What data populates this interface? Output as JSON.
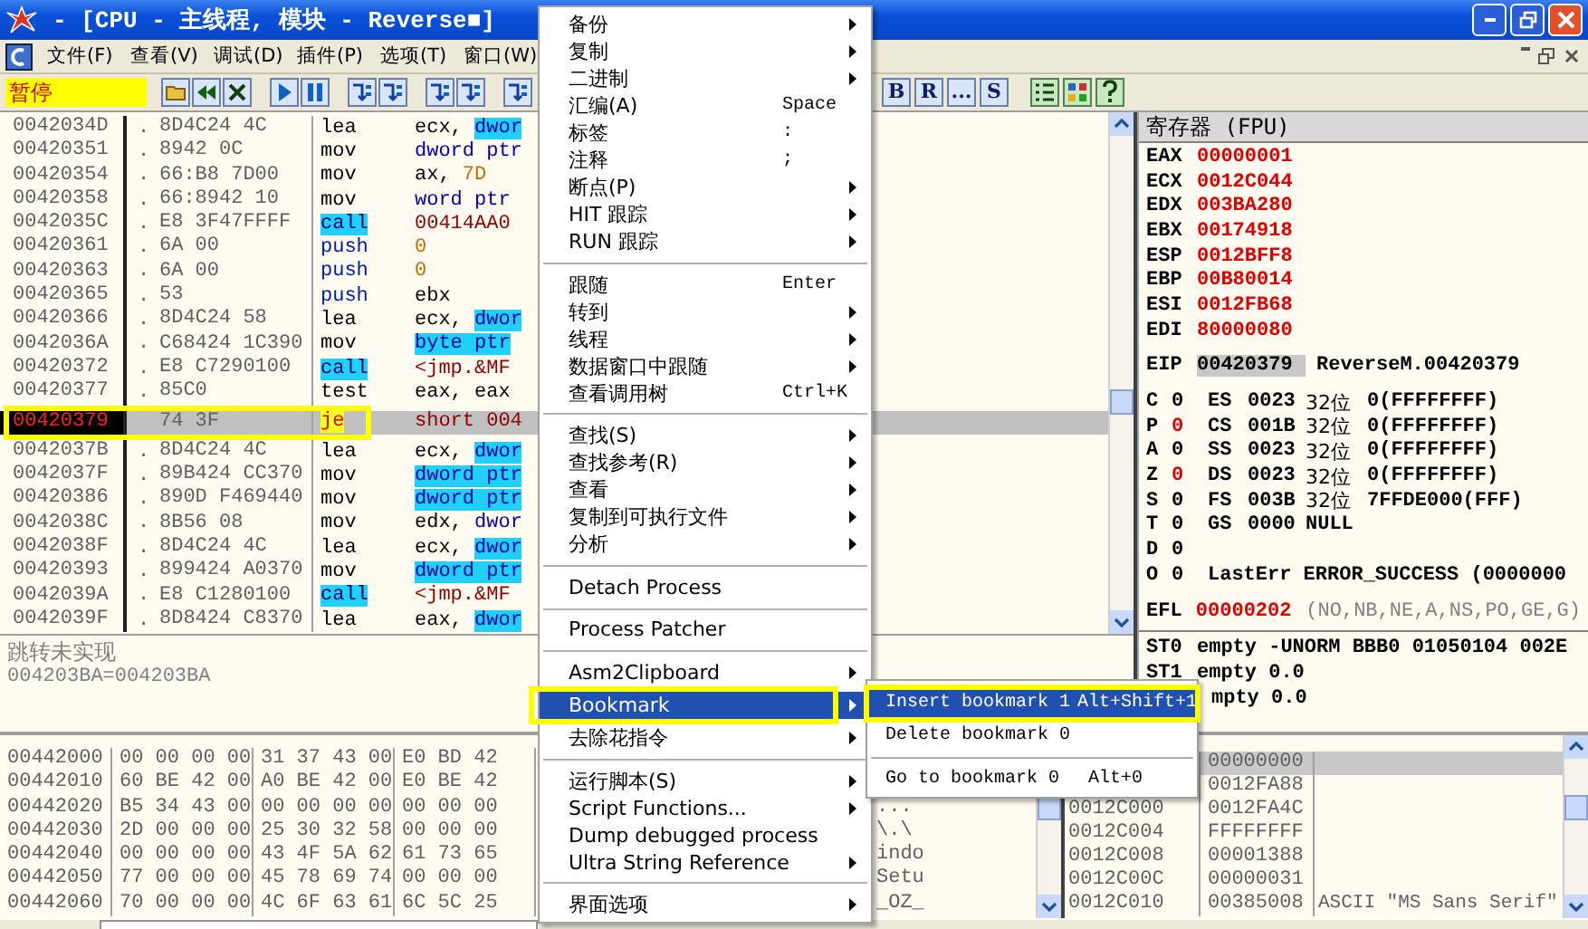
{
  "window": {
    "title": "- [CPU -  主线程, 模块 - Reverse■]"
  },
  "menubar": [
    {
      "label": "文件(F)"
    },
    {
      "label": "查看(V)"
    },
    {
      "label": "调试(D)"
    },
    {
      "label": "插件(P)"
    },
    {
      "label": "选项(T)"
    },
    {
      "label": "窗口(W)"
    }
  ],
  "toolbar": {
    "status": "暂停",
    "letter_buttons": [
      "B",
      "R",
      "...",
      "S"
    ]
  },
  "disassembly": [
    {
      "address": "0042034D",
      "path": ".",
      "hex": "8D4C24 4C",
      "mnemonic": "lea",
      "kind": "plain",
      "operand": [
        {
          "text": "ecx, ",
          "kind": "plain"
        },
        {
          "text": "dwor",
          "kind": "mem"
        }
      ],
      "selected": false
    },
    {
      "address": "00420351",
      "path": ".",
      "hex": "8942 0C",
      "mnemonic": "mov",
      "kind": "plain",
      "operand": [
        {
          "text": "dword ptr",
          "kind": "ptr"
        }
      ],
      "selected": false
    },
    {
      "address": "00420354",
      "path": ".",
      "hex": "66:B8 7D00",
      "mnemonic": "mov",
      "kind": "plain",
      "operand": [
        {
          "text": "ax, ",
          "kind": "plain"
        },
        {
          "text": "7D",
          "kind": "num"
        }
      ],
      "selected": false
    },
    {
      "address": "00420358",
      "path": ".",
      "hex": "66:8942 10",
      "mnemonic": "mov",
      "kind": "plain",
      "operand": [
        {
          "text": "word ptr",
          "kind": "ptr"
        }
      ],
      "selected": false
    },
    {
      "address": "0042035C",
      "path": ".",
      "hex": "E8 3F47FFFF",
      "mnemonic": "call",
      "kind": "call",
      "operand": [
        {
          "text": "00414AA0",
          "kind": "target"
        }
      ],
      "selected": false
    },
    {
      "address": "00420361",
      "path": ".",
      "hex": "6A 00",
      "mnemonic": "push",
      "kind": "push",
      "operand": [
        {
          "text": "0",
          "kind": "num"
        }
      ],
      "selected": false
    },
    {
      "address": "00420363",
      "path": ".",
      "hex": "6A 00",
      "mnemonic": "push",
      "kind": "push",
      "operand": [
        {
          "text": "0",
          "kind": "num"
        }
      ],
      "selected": false
    },
    {
      "address": "00420365",
      "path": ".",
      "hex": "53",
      "mnemonic": "push",
      "kind": "push",
      "operand": [
        {
          "text": "ebx",
          "kind": "plain"
        }
      ],
      "selected": false
    },
    {
      "address": "00420366",
      "path": ".",
      "hex": "8D4C24 58",
      "mnemonic": "lea",
      "kind": "plain",
      "operand": [
        {
          "text": "ecx, ",
          "kind": "plain"
        },
        {
          "text": "dwor",
          "kind": "mem"
        }
      ],
      "selected": false
    },
    {
      "address": "0042036A",
      "path": ".",
      "hex": "C68424 1C390",
      "mnemonic": "mov",
      "kind": "plain",
      "operand": [
        {
          "text": "byte ptr",
          "kind": "mem"
        }
      ],
      "selected": false
    },
    {
      "address": "00420372",
      "path": ".",
      "hex": "E8 C7290100",
      "mnemonic": "call",
      "kind": "call",
      "operand": [
        {
          "text": "<jmp.&MF",
          "kind": "target"
        }
      ],
      "selected": false
    },
    {
      "address": "00420377",
      "path": ".",
      "hex": "85C0",
      "mnemonic": "test",
      "kind": "plain",
      "operand": [
        {
          "text": "eax, eax",
          "kind": "plain"
        }
      ],
      "selected": false
    },
    {
      "address": "00420379",
      "hex": "74 3F",
      "mnemonic": "je",
      "kind": "jump",
      "operand": [
        {
          "text": "short 004",
          "kind": "target"
        }
      ],
      "selected": true,
      "highlighted": true
    },
    {
      "address": "0042037B",
      "path": ".",
      "hex": "8D4C24 4C",
      "mnemonic": "lea",
      "kind": "plain",
      "operand": [
        {
          "text": "ecx, ",
          "kind": "plain"
        },
        {
          "text": "dwor",
          "kind": "mem"
        }
      ],
      "selected": false
    },
    {
      "address": "0042037F",
      "path": ".",
      "hex": "89B424 CC370",
      "mnemonic": "mov",
      "kind": "plain",
      "operand": [
        {
          "text": "dword ptr",
          "kind": "mem"
        }
      ],
      "selected": false
    },
    {
      "address": "00420386",
      "path": ".",
      "hex": "890D F469440",
      "mnemonic": "mov",
      "kind": "plain",
      "operand": [
        {
          "text": "dword ptr",
          "kind": "mem"
        }
      ],
      "selected": false
    },
    {
      "address": "0042038C",
      "path": ".",
      "hex": "8B56 08",
      "mnemonic": "mov",
      "kind": "plain",
      "operand": [
        {
          "text": "edx, ",
          "kind": "plain"
        },
        {
          "text": "dwor",
          "kind": "ptr"
        }
      ],
      "selected": false
    },
    {
      "address": "0042038F",
      "path": ".",
      "hex": "8D4C24 4C",
      "mnemonic": "lea",
      "kind": "plain",
      "operand": [
        {
          "text": "ecx, ",
          "kind": "plain"
        },
        {
          "text": "dwor",
          "kind": "mem"
        }
      ],
      "selected": false
    },
    {
      "address": "00420393",
      "path": ".",
      "hex": "899424 A0370",
      "mnemonic": "mov",
      "kind": "plain",
      "operand": [
        {
          "text": "dword ptr",
          "kind": "mem"
        }
      ],
      "selected": false
    },
    {
      "address": "0042039A",
      "path": ".",
      "hex": "E8 C1280100",
      "mnemonic": "call",
      "kind": "call",
      "operand": [
        {
          "text": "<jmp.&MF",
          "kind": "target"
        }
      ],
      "selected": false
    },
    {
      "address": "0042039F",
      "path": ".",
      "hex": "8D8424 C8370",
      "mnemonic": "lea",
      "kind": "plain",
      "operand": [
        {
          "text": "eax, ",
          "kind": "plain"
        },
        {
          "text": "dwor",
          "kind": "mem"
        }
      ],
      "selected": false
    }
  ],
  "info": [
    "跳转未实现",
    "004203BA=004203BA"
  ],
  "registers": {
    "title": "寄存器 (FPU)",
    "general": [
      {
        "name": "EAX",
        "value": "00000001",
        "changed": true
      },
      {
        "name": "ECX",
        "value": "0012C044",
        "changed": true
      },
      {
        "name": "EDX",
        "value": "003BA280",
        "changed": true
      },
      {
        "name": "EBX",
        "value": "00174918",
        "changed": true
      },
      {
        "name": "ESP",
        "value": "0012BFF8",
        "changed": true
      },
      {
        "name": "EBP",
        "value": "00B80014",
        "changed": true
      },
      {
        "name": "ESI",
        "value": "0012FB68",
        "changed": true
      },
      {
        "name": "EDI",
        "value": "80000080",
        "changed": true
      }
    ],
    "eip": {
      "name": "EIP",
      "value": "00420379",
      "comment": "ReverseM.00420379"
    },
    "flags": [
      {
        "flag": "C",
        "value": "0",
        "changed": false,
        "segment": "ES",
        "selector": "0023",
        "bits": "32位",
        "info": "0(FFFFFFFF)"
      },
      {
        "flag": "P",
        "value": "0",
        "changed": true,
        "segment": "CS",
        "selector": "001B",
        "bits": "32位",
        "info": "0(FFFFFFFF)"
      },
      {
        "flag": "A",
        "value": "0",
        "changed": false,
        "segment": "SS",
        "selector": "0023",
        "bits": "32位",
        "info": "0(FFFFFFFF)"
      },
      {
        "flag": "Z",
        "value": "0",
        "changed": true,
        "segment": "DS",
        "selector": "0023",
        "bits": "32位",
        "info": "0(FFFFFFFF)"
      },
      {
        "flag": "S",
        "value": "0",
        "changed": false,
        "segment": "FS",
        "selector": "003B",
        "bits": "32位",
        "info": "7FFDE000(FFF)"
      },
      {
        "flag": "T",
        "value": "0",
        "changed": false,
        "segment": "GS",
        "selector": "0000",
        "info": "NULL"
      },
      {
        "flag": "D",
        "value": "0",
        "changed": false
      },
      {
        "flag": "O",
        "value": "0",
        "changed": false,
        "info": "LastErr ERROR_SUCCESS (0000000"
      }
    ],
    "efl": {
      "name": "EFL",
      "value": "00000202",
      "changed": true,
      "info": "(NO,NB,NE,A,NS,PO,GE,G)"
    },
    "fpu": [
      {
        "name": "ST0",
        "text": "empty -UNORM BBB0 01050104 002E"
      },
      {
        "name": "ST1",
        "text": "empty 0.0"
      },
      {
        "text": "mpty 0.0"
      }
    ]
  },
  "dump": [
    {
      "address": "00442000",
      "groups": [
        "00 00 00 00",
        "31 37 43 00",
        "E0 BD 42"
      ]
    },
    {
      "address": "00442010",
      "groups": [
        "60 BE 42 00",
        "A0 BE 42 00",
        "E0 BE 42"
      ]
    },
    {
      "address": "00442020",
      "groups": [
        "B5 34 43 00",
        "00 00 00 00",
        "00 00 00"
      ],
      "ascii": "..."
    },
    {
      "address": "00442030",
      "groups": [
        "2D 00 00 00",
        "25 30 32 58",
        "00 00 00"
      ],
      "ascii": "\\.\\"
    },
    {
      "address": "00442040",
      "groups": [
        "00 00 00 00",
        "43 4F 5A 62",
        "61 73 65"
      ],
      "ascii": "indo"
    },
    {
      "address": "00442050",
      "groups": [
        "77 00 00 00",
        "45 78 69 74",
        "00 00 00"
      ],
      "ascii": "Setu"
    },
    {
      "address": "00442060",
      "groups": [
        "70 00 00 00",
        "4C 6F 63 61",
        "6C 5C 25"
      ],
      "ascii": "_OZ_"
    }
  ],
  "stack": [
    {
      "value": "00000000",
      "selected": true
    },
    {
      "value": "0012FA88",
      "selected": false
    },
    {
      "address": "0012C000",
      "value": "0012FA4C",
      "selected": false
    },
    {
      "address": "0012C004",
      "value": "FFFFFFFF",
      "selected": false
    },
    {
      "address": "0012C008",
      "value": "00001388",
      "selected": false
    },
    {
      "address": "0012C00C",
      "value": "00000031",
      "selected": false
    },
    {
      "address": "0012C010",
      "value": "00385008",
      "comment": "ASCII \"MS Sans Serif\"",
      "selected": false
    }
  ],
  "context_menu": [
    {
      "kind": "item",
      "label": "备份",
      "submenu": true,
      "selected": false
    },
    {
      "kind": "item",
      "label": "复制",
      "submenu": true,
      "selected": false
    },
    {
      "kind": "item",
      "label": "二进制",
      "submenu": true,
      "selected": false
    },
    {
      "kind": "item",
      "label": "汇编(A)",
      "shortcut": "Space",
      "submenu": false,
      "selected": false
    },
    {
      "kind": "item",
      "label": "标签",
      "shortcut": ":",
      "submenu": false,
      "selected": false
    },
    {
      "kind": "item",
      "label": "注释",
      "shortcut": ";",
      "submenu": false,
      "selected": false
    },
    {
      "kind": "item",
      "label": "断点(P)",
      "submenu": true,
      "selected": false
    },
    {
      "kind": "item",
      "label": "HIT 跟踪",
      "submenu": true,
      "selected": false
    },
    {
      "kind": "item",
      "label": "RUN 跟踪",
      "submenu": true,
      "selected": false
    },
    {
      "kind": "separator"
    },
    {
      "kind": "item",
      "label": "跟随",
      "shortcut": "Enter",
      "submenu": false,
      "selected": false
    },
    {
      "kind": "item",
      "label": "转到",
      "submenu": true,
      "selected": false
    },
    {
      "kind": "item",
      "label": "线程",
      "submenu": true,
      "selected": false
    },
    {
      "kind": "item",
      "label": "数据窗口中跟随",
      "submenu": true,
      "selected": false
    },
    {
      "kind": "item",
      "label": "查看调用树",
      "shortcut": "Ctrl+K",
      "submenu": false,
      "selected": false
    },
    {
      "kind": "separator"
    },
    {
      "kind": "item",
      "label": "查找(S)",
      "submenu": true,
      "selected": false
    },
    {
      "kind": "item",
      "label": "查找参考(R)",
      "submenu": true,
      "selected": false
    },
    {
      "kind": "item",
      "label": "查看",
      "submenu": true,
      "selected": false
    },
    {
      "kind": "item",
      "label": "复制到可执行文件",
      "submenu": true,
      "selected": false
    },
    {
      "kind": "item",
      "label": "分析",
      "submenu": true,
      "selected": false
    },
    {
      "kind": "separator"
    },
    {
      "kind": "item",
      "label": "Detach Process",
      "submenu": false,
      "selected": false
    },
    {
      "kind": "separator"
    },
    {
      "kind": "item",
      "label": "Process Patcher",
      "submenu": false,
      "selected": false
    },
    {
      "kind": "separator"
    },
    {
      "kind": "item",
      "label": "Asm2Clipboard",
      "submenu": true,
      "selected": false
    },
    {
      "kind": "item",
      "label": "Bookmark",
      "submenu": true,
      "selected": true,
      "highlighted": true
    },
    {
      "kind": "item",
      "label": "去除花指令",
      "submenu": true,
      "selected": false
    },
    {
      "kind": "separator"
    },
    {
      "kind": "item",
      "label": "运行脚本(S)",
      "submenu": true,
      "selected": false
    },
    {
      "kind": "item",
      "label": "Script Functions...",
      "submenu": true,
      "selected": false
    },
    {
      "kind": "item",
      "label": "Dump debugged process",
      "submenu": false,
      "selected": false
    },
    {
      "kind": "item",
      "label": "Ultra String Reference",
      "submenu": true,
      "selected": false
    },
    {
      "kind": "separator"
    },
    {
      "kind": "item",
      "label": "界面选项",
      "submenu": true,
      "selected": false
    }
  ],
  "submenu": [
    {
      "kind": "item",
      "label": "Insert bookmark 1",
      "shortcut": "Alt+Shift+1",
      "selected": true,
      "highlighted": true
    },
    {
      "kind": "item",
      "label": "Delete bookmark 0",
      "selected": false
    },
    {
      "kind": "separator"
    },
    {
      "kind": "item",
      "label": "Go to bookmark 0",
      "shortcut": "Alt+0",
      "selected": false
    }
  ]
}
